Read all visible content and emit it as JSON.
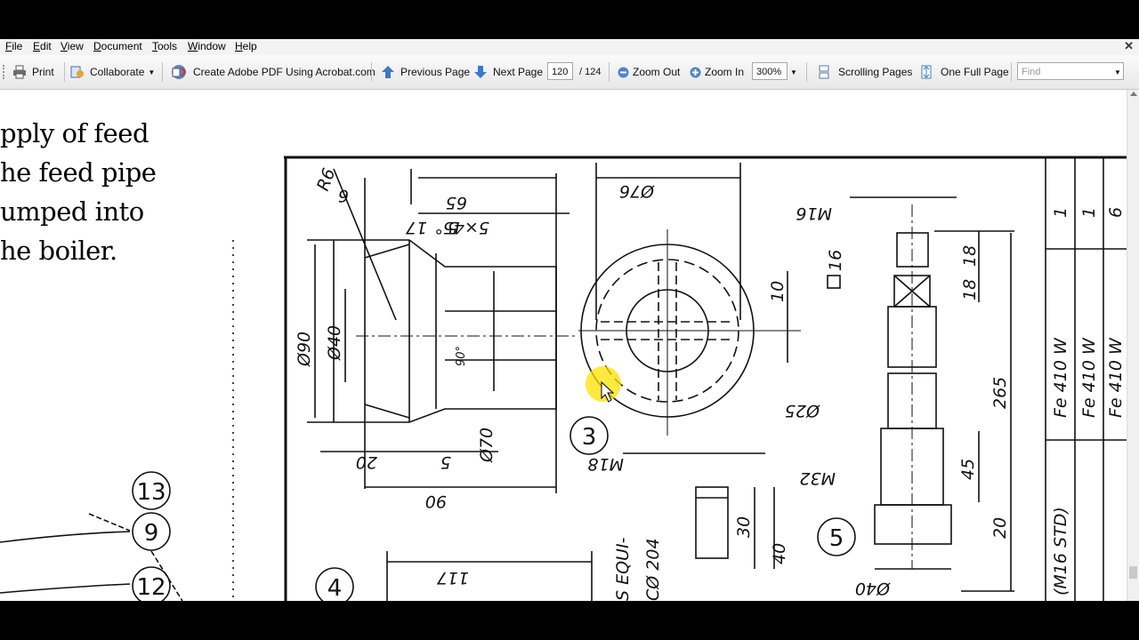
{
  "menu": [
    "File",
    "Edit",
    "View",
    "Document",
    "Tools",
    "Window",
    "Help"
  ],
  "toolbar": {
    "print": "Print",
    "collaborate": "Collaborate",
    "create_pdf": "Create Adobe PDF Using Acrobat.com",
    "previous_page": "Previous Page",
    "next_page": "Next Page",
    "page_current": "120",
    "page_total": "/ 124",
    "zoom_out": "Zoom Out",
    "zoom_in": "Zoom In",
    "zoom_level": "300%",
    "scrolling_pages": "Scrolling Pages",
    "one_full_page": "One Full Page",
    "find_placeholder": "Find"
  },
  "prose": [
    "pply of feed",
    "he feed pipe",
    "umped into",
    "he boiler."
  ],
  "drawing": {
    "balloons": [
      "13",
      "9",
      "12",
      "3",
      "4",
      "5"
    ],
    "part3": {
      "dims": [
        "R6",
        "6",
        "65",
        "17",
        "5",
        "5×45°",
        "Ø90",
        "Ø40",
        "90°",
        "20",
        "5",
        "Ø70",
        "90",
        "Ø76",
        "10"
      ]
    },
    "part4": {
      "dims": [
        "M18",
        "117",
        "30",
        "40"
      ]
    },
    "part5": {
      "dims": [
        "M16",
        "16",
        "18",
        "18",
        "265",
        "Ø25",
        "M32",
        "45",
        "20",
        "Ø40"
      ]
    },
    "table_qty": [
      "1",
      "1",
      "6"
    ],
    "table_material": [
      "Fe 410 W",
      "Fe 410 W",
      "Fe 410 W"
    ],
    "table_note": "(M16 STD)",
    "fragment_note_1": "S EQUI-",
    "fragment_note_2": "CØ 204"
  },
  "icons": [
    "print-icon",
    "collaborate-icon",
    "acrobat-com-icon",
    "previous-page-icon",
    "next-page-icon",
    "zoom-out-icon",
    "zoom-in-icon",
    "scrolling-pages-icon",
    "one-full-page-icon",
    "close-icon"
  ]
}
